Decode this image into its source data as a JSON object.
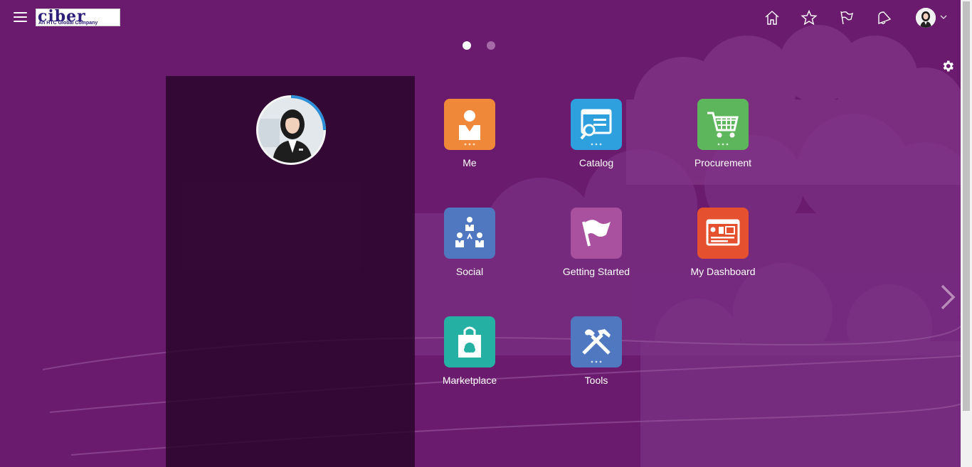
{
  "header": {
    "logo_text": "ciber",
    "logo_subtext": "An HTC Global Company",
    "icons": [
      "home-icon",
      "star-icon",
      "flag-icon",
      "bell-icon"
    ]
  },
  "pager": {
    "current_page": 1,
    "total_pages": 2
  },
  "tiles": [
    {
      "label": "Me",
      "color": "#f0883a",
      "icon": "person-icon"
    },
    {
      "label": "Catalog",
      "color": "#2ea0dd",
      "icon": "catalog-search-icon"
    },
    {
      "label": "Procurement",
      "color": "#5db65b",
      "icon": "shopping-cart-icon"
    },
    {
      "label": "Social",
      "color": "#4f78c0",
      "icon": "people-network-icon"
    },
    {
      "label": "Getting Started",
      "color": "#a9519f",
      "icon": "flag-icon"
    },
    {
      "label": "My Dashboard",
      "color": "#e5502f",
      "icon": "dashboard-icon"
    },
    {
      "label": "Marketplace",
      "color": "#25b0a4",
      "icon": "shopping-bag-icon"
    },
    {
      "label": "Tools",
      "color": "#4f78c0",
      "icon": "wrench-hammer-icon"
    }
  ],
  "colors": {
    "background": "#6a1b6e",
    "panel": "#2d0a30"
  }
}
